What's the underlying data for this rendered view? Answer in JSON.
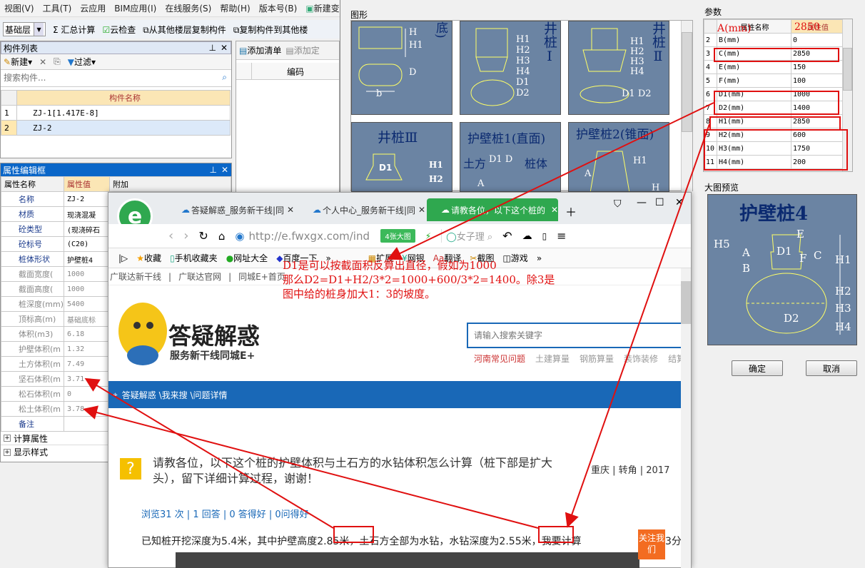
{
  "menubar": [
    "视图(V)",
    "工具(T)",
    "云应用",
    "BIM应用(I)",
    "在线服务(S)",
    "帮助(H)",
    "版本号(B)",
    "新建变"
  ],
  "toolbar": {
    "floor": "基础层",
    "sum": "汇总计算",
    "cloud": "云检查",
    "copy_floor": "从其他楼层复制构件",
    "copy_to": "复制构件到其他楼"
  },
  "component_list": {
    "title": "构件列表",
    "new": "新建",
    "filter": "过滤",
    "search_placeholder": "搜索构件...",
    "col_name": "构件名称",
    "rows": [
      {
        "n": "1",
        "name": "ZJ-1[1.417E-8]"
      },
      {
        "n": "2",
        "name": "ZJ-2"
      }
    ]
  },
  "list2": {
    "add_list": "添加清单",
    "add_quota": "添加定",
    "col_code": "编码"
  },
  "prop_editor": {
    "title": "属性编辑框",
    "col_name": "属性名称",
    "col_value": "属性值",
    "col_extra": "附加",
    "rows": [
      {
        "name": "名称",
        "value": "ZJ-2",
        "blue": true
      },
      {
        "name": "材质",
        "value": "现浇混凝",
        "blue": true
      },
      {
        "name": "砼类型",
        "value": "(现浇碎石",
        "blue": true
      },
      {
        "name": "砼标号",
        "value": "(C20)",
        "blue": true
      },
      {
        "name": "桩体形状",
        "value": "护壁桩4",
        "blue": true
      },
      {
        "name": "截面宽度(",
        "value": "1000",
        "blue": false
      },
      {
        "name": "截面高度(",
        "value": "1000",
        "blue": false
      },
      {
        "name": "桩深度(mm)",
        "value": "5400",
        "blue": false
      },
      {
        "name": "顶标高(m)",
        "value": "基础底标",
        "blue": false
      },
      {
        "name": "体积(m3)",
        "value": "6.18",
        "blue": false
      },
      {
        "name": "护壁体积(m",
        "value": "1.32",
        "blue": false
      },
      {
        "name": "土方体积(m",
        "value": "7.49",
        "blue": false
      },
      {
        "name": "坚石体积(m",
        "value": "3.71",
        "blue": false
      },
      {
        "name": "松石体积(m",
        "value": "0",
        "blue": false
      },
      {
        "name": "松土体积(m",
        "value": "3.78",
        "blue": false
      },
      {
        "name": "备注",
        "value": "",
        "blue": true
      }
    ],
    "group1": "计算属性",
    "group2": "显示样式"
  },
  "dialog": {
    "figure_title": "图形",
    "param_title": "参数",
    "preview_title": "大图预览",
    "ok": "确定",
    "cancel": "取消",
    "thumbs": [
      "长圆柱桩(球冠底)",
      "井桩Ⅰ",
      "井桩Ⅱ",
      "井桩Ⅲ",
      "护壁桩1(直面)",
      "护壁桩2(锥面)"
    ],
    "thumb_sub": [
      "H",
      "H1",
      "D",
      "b",
      "H1",
      "H2",
      "H3",
      "H4",
      "D1",
      "D2",
      "H1",
      "H2",
      "H3",
      "H4",
      "D1 D2",
      "D1",
      "H1",
      "H2",
      "土方",
      "桩体",
      "A",
      "D1 D",
      "H1",
      "A",
      "H"
    ],
    "preview_name": "护壁桩4",
    "preview_labels": [
      "H5",
      "A",
      "B",
      "D1",
      "E",
      "F",
      "C",
      "H1",
      "H2",
      "H3",
      "H4",
      "D2"
    ],
    "param_head": [
      "属性名称",
      "属性值"
    ],
    "params": [
      {
        "n": "2",
        "name": "B(mm)",
        "value": "0"
      },
      {
        "n": "3",
        "name": "C(mm)",
        "value": "2850"
      },
      {
        "n": "4",
        "name": "E(mm)",
        "value": "150"
      },
      {
        "n": "5",
        "name": "F(mm)",
        "value": "100"
      },
      {
        "n": "6",
        "name": "D1(mm)",
        "value": "1000"
      },
      {
        "n": "7",
        "name": "D2(mm)",
        "value": "1400"
      },
      {
        "n": "8",
        "name": "H1(mm)",
        "value": "2850"
      },
      {
        "n": "9",
        "name": "H2(mm)",
        "value": "600"
      },
      {
        "n": "10",
        "name": "H3(mm)",
        "value": "1750"
      },
      {
        "n": "11",
        "name": "H4(mm)",
        "value": "200"
      }
    ],
    "overlay_a": "A(mm)",
    "overlay_v": "2850"
  },
  "browser": {
    "tabs": [
      "答疑解惑_服务新干线|同",
      "个人中心_服务新干线|同",
      "请教各位，以下这个桩的"
    ],
    "url": "http://e.fwxgx.com/ind",
    "big_img": "4张大图",
    "search_hint": "女子理",
    "bookmarks": [
      "收藏",
      "手机收藏夹",
      "网址大全",
      "百度一下",
      "»",
      "扩展",
      "网银",
      "翻译",
      "截图",
      "游戏",
      "»"
    ],
    "topnav": [
      "广联达新干线",
      "广联达官网",
      "同城E+首页"
    ],
    "logo_title": "答疑解惑",
    "logo_sub": "服务新干线同城E+",
    "search_placeholder": "请输入搜索关键字",
    "hot": [
      "河南常见问题",
      "土建算量",
      "钢筋算量",
      "装饰装修",
      "结算"
    ],
    "crumb": "答疑解惑 \\我来搜 \\问题详情",
    "question": "请教各位，以下这个桩的护壁体积与土石方的水钻体积怎么计算（桩下部是扩大头），留下详细计算过程，谢谢！",
    "meta_right": "重庆 | 转角 | 2017",
    "stats": "浏览31 次 | 1 回答 | 0 答得好 | 0问得好",
    "body": "已知桩开挖深度为5.4米，其中护壁高度2.85米，土石方全部为水钻，水钻深度为2.55米，我要计算",
    "body_tail": "3分",
    "follow": "关注我们"
  },
  "annotation": {
    "line1": "D1是可以按截面积反算出直径，假如为1000",
    "line2": "那么D2=D1+H2/3*2=1000+600/3*2=1400。除3是",
    "line3": "图中给的桩身加大1：3的坡度。"
  },
  "colors": {
    "red": "#e01010",
    "blue_head": "#0a66c8",
    "brand_green": "#2fa84f",
    "nav_blue": "#1968b7"
  }
}
